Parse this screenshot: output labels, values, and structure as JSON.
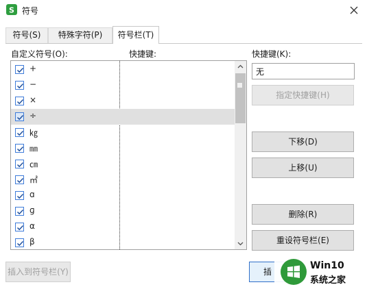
{
  "window": {
    "title": "符号"
  },
  "tabs": [
    {
      "label": "符号(S)"
    },
    {
      "label": "特殊字符(P)"
    },
    {
      "label": "符号栏(T)"
    }
  ],
  "panel": {
    "list_header": "自定义符号(O):",
    "shortcut_header": "快捷键:",
    "rows": [
      {
        "symbol": "+",
        "checked": true,
        "selected": false
      },
      {
        "symbol": "−",
        "checked": true,
        "selected": false
      },
      {
        "symbol": "×",
        "checked": true,
        "selected": false
      },
      {
        "symbol": "÷",
        "checked": true,
        "selected": true
      },
      {
        "symbol": "㎏",
        "checked": true,
        "selected": false
      },
      {
        "symbol": "㎜",
        "checked": true,
        "selected": false
      },
      {
        "symbol": "㎝",
        "checked": true,
        "selected": false
      },
      {
        "symbol": "㎡",
        "checked": true,
        "selected": false
      },
      {
        "symbol": "ɑ",
        "checked": true,
        "selected": false
      },
      {
        "symbol": "ɡ",
        "checked": true,
        "selected": false
      },
      {
        "symbol": "α",
        "checked": true,
        "selected": false
      },
      {
        "symbol": "β",
        "checked": true,
        "selected": false
      }
    ],
    "hotkey_label": "快捷键(K):",
    "hotkey_value": "无",
    "buttons": {
      "assign": "指定快捷键(H)",
      "move_down": "下移(D)",
      "move_up": "上移(U)",
      "delete": "删除(R)",
      "reset": "重设符号栏(E)"
    }
  },
  "footer": {
    "insert_to_bar": "插入到符号栏(Y)",
    "insert": "插"
  },
  "watermark": {
    "line1": "Win10",
    "line2": "系统之家"
  },
  "colors": {
    "accent": "#3d7bd9",
    "brand_green": "#2e9e3f",
    "selected_row": "#e0e0e0"
  }
}
